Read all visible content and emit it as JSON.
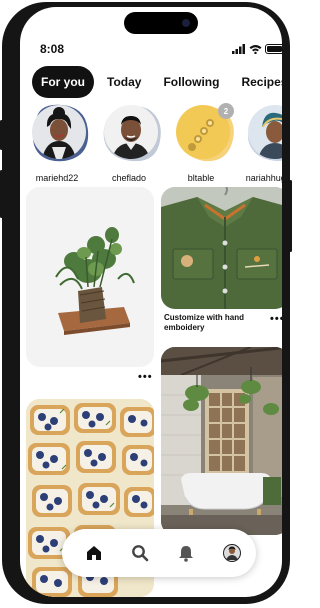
{
  "status": {
    "time": "8:08"
  },
  "tabs": [
    {
      "label": "For you",
      "active": true
    },
    {
      "label": "Today",
      "active": false
    },
    {
      "label": "Following",
      "active": false
    },
    {
      "label": "Recipes",
      "active": false
    }
  ],
  "boards": [
    {
      "name": "mariehd22"
    },
    {
      "name": "cheflado"
    },
    {
      "name": "bltable",
      "badge": "2"
    },
    {
      "name": "nariahhughes"
    }
  ],
  "pins": [
    {
      "subject": "plant-arrangement"
    },
    {
      "subject": "embroidered-jacket",
      "title": "Customize with hand emboidery"
    },
    {
      "subject": "blueberry-toasts"
    },
    {
      "subject": "bathroom-interior"
    }
  ],
  "nav": [
    "home-icon",
    "search-icon",
    "bell-icon",
    "profile-avatar"
  ],
  "colors": {
    "accent": "#111111",
    "background": "#ffffff",
    "frame": "#151515"
  }
}
